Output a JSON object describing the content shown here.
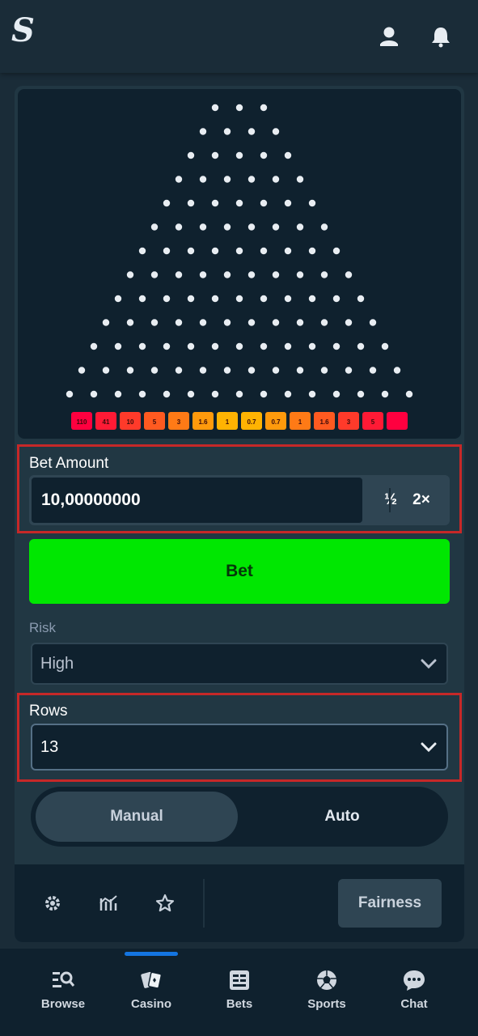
{
  "header": {
    "logo_text": "S",
    "icons": [
      "user-icon",
      "bell-icon"
    ]
  },
  "board": {
    "rows": 13,
    "multipliers": [
      "110",
      "41",
      "10",
      "5",
      "3",
      "1.6",
      "1",
      "0.7",
      "0.7",
      "1",
      "1.6",
      "3",
      "5"
    ],
    "bucket_colors": [
      "#ff003f",
      "#ff1a35",
      "#ff3a2a",
      "#ff5a20",
      "#ff7a16",
      "#ff9a0c",
      "#ffb302",
      "#ffb302",
      "#ff9a0c",
      "#ff7a16",
      "#ff5a20",
      "#ff3a2a",
      "#ff1a35",
      "#ff003f"
    ]
  },
  "bet_amount": {
    "label": "Bet Amount",
    "value": "10,00000000",
    "half_label": "½",
    "double_label": "2×"
  },
  "bet_button": {
    "label": "Bet"
  },
  "risk": {
    "label": "Risk",
    "value": "High"
  },
  "rows": {
    "label": "Rows",
    "value": "13"
  },
  "mode_toggle": {
    "manual_label": "Manual",
    "auto_label": "Auto",
    "selected": "Manual"
  },
  "footer": {
    "icons": [
      "settings-icon",
      "stats-icon",
      "star-icon"
    ],
    "fairness_label": "Fairness"
  },
  "bottom_nav": {
    "active": "Casino",
    "items": [
      {
        "label": "Browse",
        "icon": "browse-icon"
      },
      {
        "label": "Casino",
        "icon": "casino-icon"
      },
      {
        "label": "Bets",
        "icon": "bets-icon"
      },
      {
        "label": "Sports",
        "icon": "sports-icon"
      },
      {
        "label": "Chat",
        "icon": "chat-icon"
      }
    ]
  },
  "colors": {
    "background": "#1a2c38",
    "panel": "#213743",
    "dark": "#0f212e",
    "bet_green": "#00e701",
    "highlight_red": "#c62828",
    "active_blue": "#1475e1"
  }
}
